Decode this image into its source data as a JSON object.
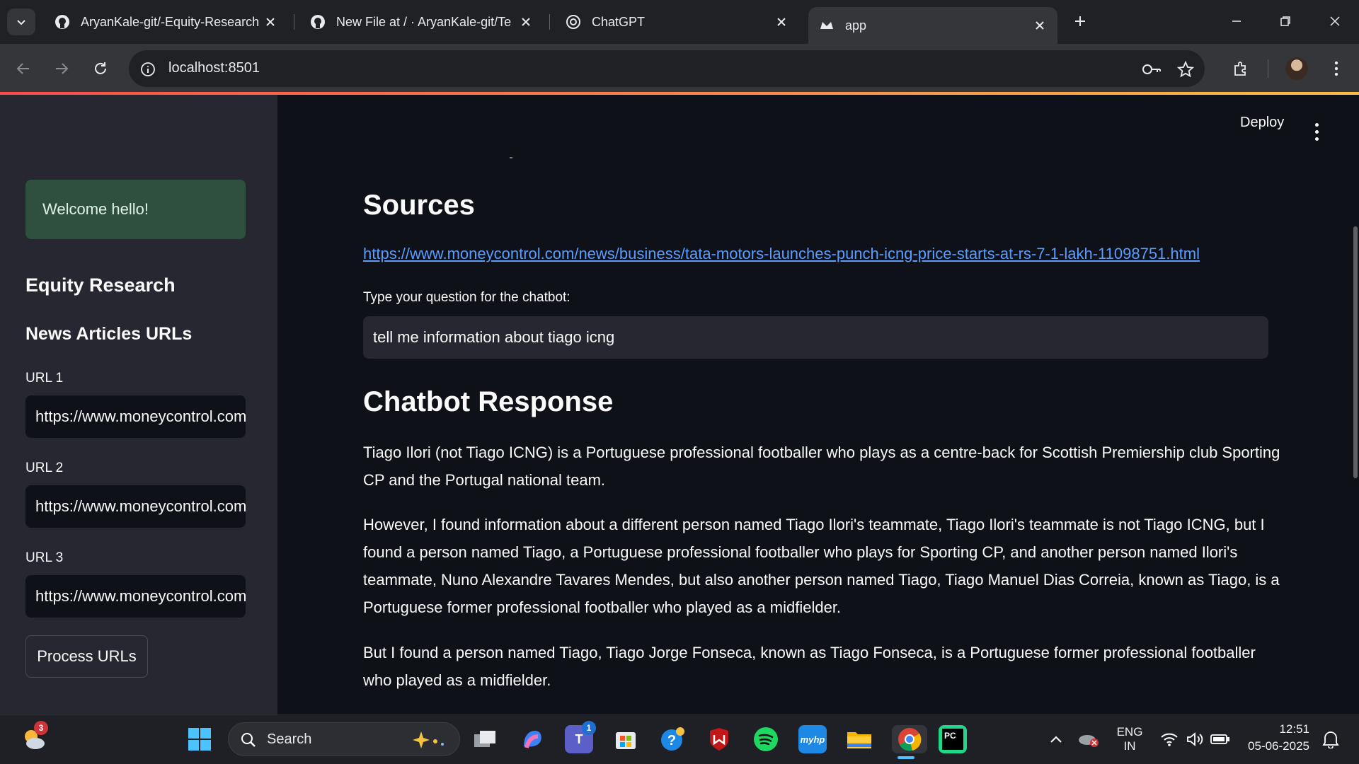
{
  "browser": {
    "tabs": [
      {
        "title": "AryanKale-git/-Equity-Research",
        "icon": "github-icon"
      },
      {
        "title": "New File at / · AryanKale-git/Te",
        "icon": "github-icon"
      },
      {
        "title": "ChatGPT",
        "icon": "chatgpt-icon"
      },
      {
        "title": "app",
        "icon": "streamlit-icon"
      }
    ],
    "url": "localhost:8501"
  },
  "sidebar": {
    "welcome": "Welcome hello!",
    "heading": "Equity Research",
    "subheading": "News Articles URLs",
    "url_fields": [
      {
        "label": "URL 1",
        "value": "https://www.moneycontrol.com/news/business/tata-motors-launches-punch-icng-price-starts-at-rs-7-1-lakh-11098751.html"
      },
      {
        "label": "URL 2",
        "value": "https://www.moneycontrol.com/news/business/tata-motors-launches-punch-icng-price-starts-at-rs-7-1-lakh-11098751.html"
      },
      {
        "label": "URL 3",
        "value": "https://www.moneycontrol.com/news/business/tata-motors-launches-punch-icng-price-starts-at-rs-7-1-lakh-11098751.html"
      }
    ],
    "process_button": "Process URLs"
  },
  "main": {
    "deploy_label": "Deploy",
    "sources_heading": "Sources",
    "source_link": "https://www.moneycontrol.com/news/business/tata-motors-launches-punch-icng-price-starts-at-rs-7-1-lakh-11098751.html",
    "question_label": "Type your question for the chatbot:",
    "question_value": "tell me information about tiago icng",
    "response_heading": "Chatbot Response",
    "response_paragraphs": [
      "Tiago Ilori (not Tiago ICNG) is a Portuguese professional footballer who plays as a centre-back for Scottish Premiership club Sporting CP and the Portugal national team.",
      "However, I found information about a different person named Tiago Ilori's teammate, Tiago Ilori's teammate is not Tiago ICNG, but I found a person named Tiago, a Portuguese professional footballer who plays for Sporting CP, and another person named Ilori's teammate, Nuno Alexandre Tavares Mendes, but also another person named Tiago, Tiago Manuel Dias Correia, known as Tiago, is a Portuguese former professional footballer who played as a midfielder.",
      "But I found a person named Tiago, Tiago Jorge Fonseca, known as Tiago Fonseca, is a Portuguese former professional footballer who played as a midfielder."
    ]
  },
  "taskbar": {
    "weather_badge": "3",
    "search_label": "Search",
    "teams_badge": "1",
    "language": "ENG",
    "region": "IN",
    "time": "12:51",
    "date": "05-06-2025"
  },
  "colors": {
    "accent": "#ff4b4b",
    "link": "#5a9cff",
    "success_bg": "#2f4f3f"
  }
}
